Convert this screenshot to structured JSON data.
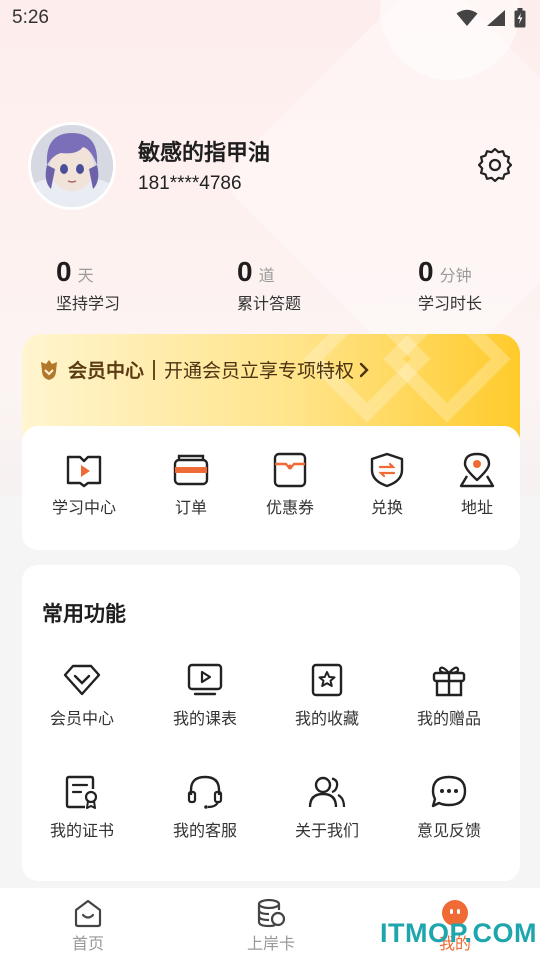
{
  "status_bar": {
    "time": "5:26"
  },
  "profile": {
    "name": "敏感的指甲油",
    "phone": "181****4786"
  },
  "stats": [
    {
      "value": "0",
      "unit": "天",
      "label": "坚持学习"
    },
    {
      "value": "0",
      "unit": "道",
      "label": "累计答题"
    },
    {
      "value": "0",
      "unit": "分钟",
      "label": "学习时长"
    }
  ],
  "vip": {
    "title": "会员中心",
    "desc": "开通会员立享专项特权"
  },
  "quick_actions": [
    {
      "label": "学习中心",
      "icon": "play-book-icon"
    },
    {
      "label": "订单",
      "icon": "wallet-icon"
    },
    {
      "label": "优惠券",
      "icon": "coupon-icon"
    },
    {
      "label": "兑换",
      "icon": "exchange-shield-icon"
    },
    {
      "label": "地址",
      "icon": "location-icon"
    }
  ],
  "common_functions": {
    "title": "常用功能",
    "items": [
      {
        "label": "会员中心",
        "icon": "diamond-icon"
      },
      {
        "label": "我的课表",
        "icon": "video-icon"
      },
      {
        "label": "我的收藏",
        "icon": "star-bookmark-icon"
      },
      {
        "label": "我的赠品",
        "icon": "gift-icon"
      },
      {
        "label": "我的证书",
        "icon": "certificate-icon"
      },
      {
        "label": "我的客服",
        "icon": "headset-icon"
      },
      {
        "label": "关于我们",
        "icon": "users-icon"
      },
      {
        "label": "意见反馈",
        "icon": "chat-bubble-icon"
      }
    ]
  },
  "tabbar": [
    {
      "label": "首页",
      "icon": "home-icon",
      "active": false
    },
    {
      "label": "上岸卡",
      "icon": "coin-stack-icon",
      "active": false
    },
    {
      "label": "我的",
      "icon": "face-icon",
      "active": true
    }
  ],
  "watermark": "ITMOP.COM",
  "colors": {
    "accent": "#f06a35",
    "vip_text": "#5a3b12",
    "watermark": "#1fa6ad"
  }
}
